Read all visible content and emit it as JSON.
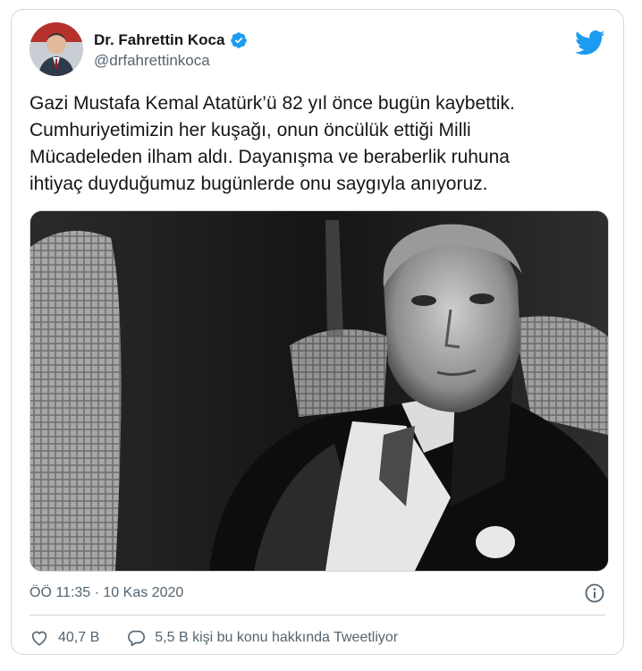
{
  "tweet": {
    "author": {
      "display_name": "Dr. Fahrettin Koca",
      "handle": "@drfahrettinkoca",
      "verified_icon": "verified-badge-icon"
    },
    "text_lines": [
      "Gazi Mustafa Kemal Atatürk’ü 82 yıl önce bugün kaybettik.",
      "Cumhuriyetimizin her kuşağı, onun öncülük ettiği Milli",
      "Mücadeleden ilham aldı. Dayanışma ve beraberlik ruhuna",
      "ihtiyaç duyduğumuz bugünlerde onu saygıyla anıyoruz."
    ],
    "timestamp": "ÖÖ 11:35 · 10 Kas 2020",
    "likes": "40,7 B",
    "conversation": "5,5 B kişi bu konu hakkında Tweetliyor"
  },
  "icons": {
    "twitter": "twitter-bird-icon",
    "info": "info-icon",
    "like": "heart-icon",
    "reply": "speech-bubble-icon"
  },
  "colors": {
    "twitter_blue": "#1d9bf0",
    "secondary_text": "#536471",
    "border": "#cfd9de"
  }
}
